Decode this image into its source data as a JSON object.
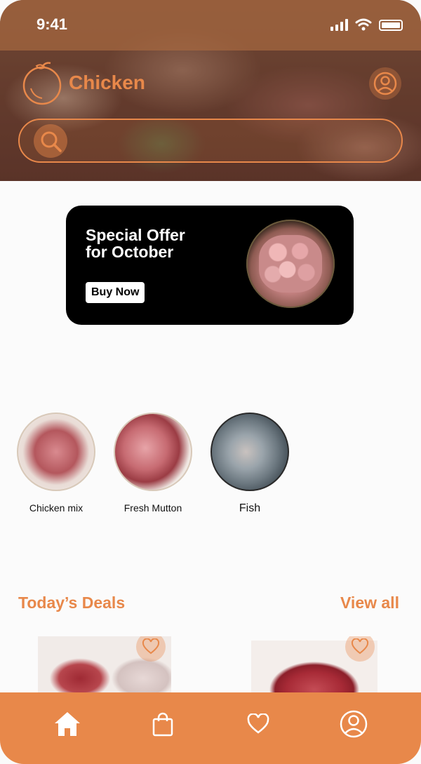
{
  "status_bar": {
    "time": "9:41"
  },
  "header": {
    "brand_name": "Chicken",
    "search": {
      "placeholder": ""
    }
  },
  "promo": {
    "title_line1": "Special Offer",
    "title_line2": "for October",
    "button_label": "Buy Now"
  },
  "categories": [
    {
      "label": "Chicken mix"
    },
    {
      "label": "Fresh Mutton"
    },
    {
      "label": "Fish"
    }
  ],
  "deals": {
    "title": "Today’s Deals",
    "view_all": "View all"
  },
  "nav": {
    "items": [
      "home-icon",
      "bag-icon",
      "heart-icon",
      "profile-icon"
    ]
  },
  "colors": {
    "accent": "#e8884a",
    "promo_bg": "#000000",
    "nav_bg": "#e8884a"
  }
}
